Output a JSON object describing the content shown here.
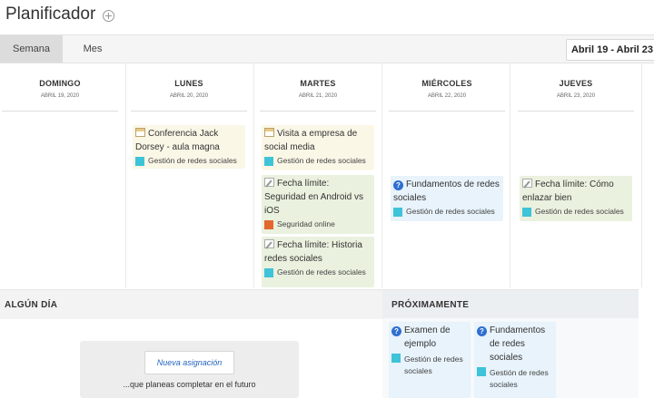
{
  "page": {
    "title": "Planificador"
  },
  "toolbar": {
    "tabs": [
      {
        "label": "Semana",
        "active": true
      },
      {
        "label": "Mes",
        "active": false
      }
    ],
    "date_range": "Abril 19 - Abril 23"
  },
  "days": [
    {
      "name": "DOMINGO",
      "date": "ABRIL 19, 2020"
    },
    {
      "name": "LUNES",
      "date": "ABRIL 20, 2020"
    },
    {
      "name": "MARTES",
      "date": "ABRIL 21, 2020"
    },
    {
      "name": "MIÉRCOLES",
      "date": "ABRIL 22, 2020"
    },
    {
      "name": "JUEVES",
      "date": "ABRIL 23, 2020"
    }
  ],
  "events": {
    "lunes_1": {
      "title": "Conferencia Jack Dorsey - aula magna",
      "course": "Gestión de redes sociales",
      "icon": "calendar-icon"
    },
    "martes_1": {
      "title": "Visita a empresa de social media",
      "course": "Gestión de redes sociales",
      "icon": "calendar-icon"
    },
    "martes_2": {
      "title": "Fecha límite: Seguridad en Android vs iOS",
      "course": "Seguridad online",
      "icon": "pencil-icon"
    },
    "martes_3": {
      "title": "Fecha límite: Historia redes sociales",
      "course": "Gestión de redes sociales",
      "icon": "pencil-icon"
    },
    "miercoles_1": {
      "title": "Fundamentos de redes sociales",
      "course": "Gestión de redes sociales",
      "icon": "quiz-icon"
    },
    "jueves_1": {
      "title": "Fecha límite: Cómo enlazar bien",
      "course": "Gestión de redes sociales",
      "icon": "pencil-icon"
    }
  },
  "sections": {
    "someday": {
      "label": "ALGÚN DÍA",
      "button": "Nueva asignación",
      "hint": "...que planeas completar en el futuro"
    },
    "upcoming": {
      "label": "PRÓXIMAMENTE",
      "items": [
        {
          "title": "Examen de ejemplo",
          "course": "Gestión de redes sociales",
          "icon": "quiz-icon"
        },
        {
          "title": "Fundamentos de redes sociales",
          "course": "Gestión de redes sociales",
          "icon": "quiz-icon"
        }
      ]
    }
  },
  "colors": {
    "teal": "#3ec3d8",
    "orange": "#e3682e",
    "quiz_blue": "#2f6fd1",
    "link_blue": "#2565c0"
  }
}
